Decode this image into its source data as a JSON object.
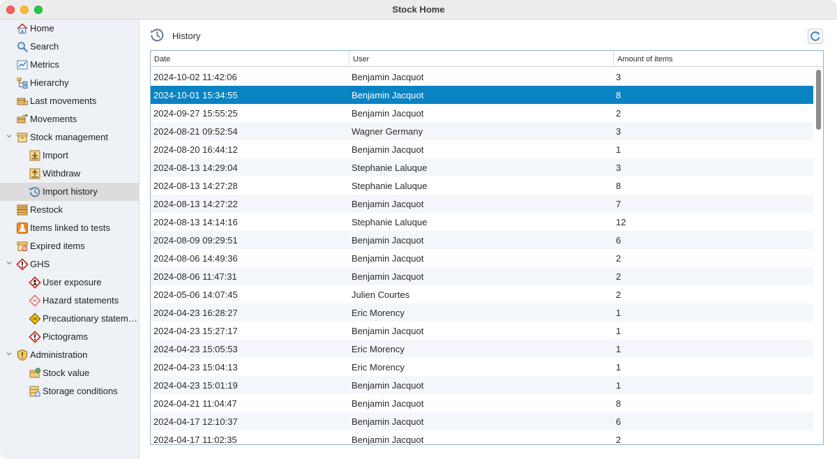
{
  "window": {
    "title": "Stock Home"
  },
  "sidebar": {
    "items": [
      {
        "label": "Home",
        "icon": "home-icon",
        "level": 0
      },
      {
        "label": "Search",
        "icon": "search-icon",
        "level": 0
      },
      {
        "label": "Metrics",
        "icon": "metrics-icon",
        "level": 0
      },
      {
        "label": "Hierarchy",
        "icon": "hierarchy-icon",
        "level": 0
      },
      {
        "label": "Last movements",
        "icon": "last-movements-icon",
        "level": 0
      },
      {
        "label": "Movements",
        "icon": "movements-icon",
        "level": 0
      },
      {
        "label": "Stock management",
        "icon": "box-icon",
        "level": 0,
        "expanded": true
      },
      {
        "label": "Import",
        "icon": "import-icon",
        "level": 1
      },
      {
        "label": "Withdraw",
        "icon": "withdraw-icon",
        "level": 1
      },
      {
        "label": "Import history",
        "icon": "history-icon",
        "level": 1,
        "selected": true
      },
      {
        "label": "Restock",
        "icon": "restock-icon",
        "level": 0
      },
      {
        "label": "Items linked to tests",
        "icon": "flask-icon",
        "level": 0
      },
      {
        "label": "Expired items",
        "icon": "expired-icon",
        "level": 0
      },
      {
        "label": "GHS",
        "icon": "ghs-warning-icon",
        "level": 0,
        "expanded": true
      },
      {
        "label": "User exposure",
        "icon": "user-exposure-icon",
        "level": 1
      },
      {
        "label": "Hazard statements",
        "icon": "hazard-icon",
        "level": 1
      },
      {
        "label": "Precautionary statements",
        "icon": "precaution-icon",
        "level": 1
      },
      {
        "label": "Pictograms",
        "icon": "pictogram-icon",
        "level": 1
      },
      {
        "label": "Administration",
        "icon": "shield-icon",
        "level": 0,
        "expanded": true
      },
      {
        "label": "Stock value",
        "icon": "stock-value-icon",
        "level": 1
      },
      {
        "label": "Storage conditions",
        "icon": "storage-icon",
        "level": 1
      }
    ]
  },
  "main": {
    "title": "History",
    "columns": [
      "Date",
      "User",
      "Amount of items"
    ],
    "selected_row": 1,
    "rows": [
      {
        "date": "2024-10-02 11:42:06",
        "user": "Benjamin Jacquot",
        "amount": "3"
      },
      {
        "date": "2024-10-01 15:34:55",
        "user": "Benjamin Jacquot",
        "amount": "8"
      },
      {
        "date": "2024-09-27 15:55:25",
        "user": "Benjamin Jacquot",
        "amount": "2"
      },
      {
        "date": "2024-08-21 09:52:54",
        "user": "Wagner Germany",
        "amount": "3"
      },
      {
        "date": "2024-08-20 16:44:12",
        "user": "Benjamin Jacquot",
        "amount": "1"
      },
      {
        "date": "2024-08-13 14:29:04",
        "user": "Stephanie Laluque",
        "amount": "3"
      },
      {
        "date": "2024-08-13 14:27:28",
        "user": "Stephanie Laluque",
        "amount": "8"
      },
      {
        "date": "2024-08-13 14:27:22",
        "user": "Benjamin Jacquot",
        "amount": "7"
      },
      {
        "date": "2024-08-13 14:14:16",
        "user": "Stephanie Laluque",
        "amount": "12"
      },
      {
        "date": "2024-08-09 09:29:51",
        "user": "Benjamin Jacquot",
        "amount": "6"
      },
      {
        "date": "2024-08-06 14:49:36",
        "user": "Benjamin Jacquot",
        "amount": "2"
      },
      {
        "date": "2024-08-06 11:47:31",
        "user": "Benjamin Jacquot",
        "amount": "2"
      },
      {
        "date": "2024-05-06 14:07:45",
        "user": "Julien Courtes",
        "amount": "2"
      },
      {
        "date": "2024-04-23 16:28:27",
        "user": "Eric Morency",
        "amount": "1"
      },
      {
        "date": "2024-04-23 15:27:17",
        "user": "Benjamin Jacquot",
        "amount": "1"
      },
      {
        "date": "2024-04-23 15:05:53",
        "user": "Eric Morency",
        "amount": "1"
      },
      {
        "date": "2024-04-23 15:04:13",
        "user": "Eric Morency",
        "amount": "1"
      },
      {
        "date": "2024-04-23 15:01:19",
        "user": "Benjamin Jacquot",
        "amount": "1"
      },
      {
        "date": "2024-04-21 11:04:47",
        "user": "Benjamin Jacquot",
        "amount": "8"
      },
      {
        "date": "2024-04-17 12:10:37",
        "user": "Benjamin Jacquot",
        "amount": "6"
      },
      {
        "date": "2024-04-17 11:02:35",
        "user": "Benjamin Jacquot",
        "amount": "2"
      }
    ]
  },
  "colors": {
    "selection": "#0a83c3",
    "sidebar_bg": "#eef2f7",
    "sidebar_selected": "#dcdcdc",
    "row_alt": "#f3f7fb"
  }
}
